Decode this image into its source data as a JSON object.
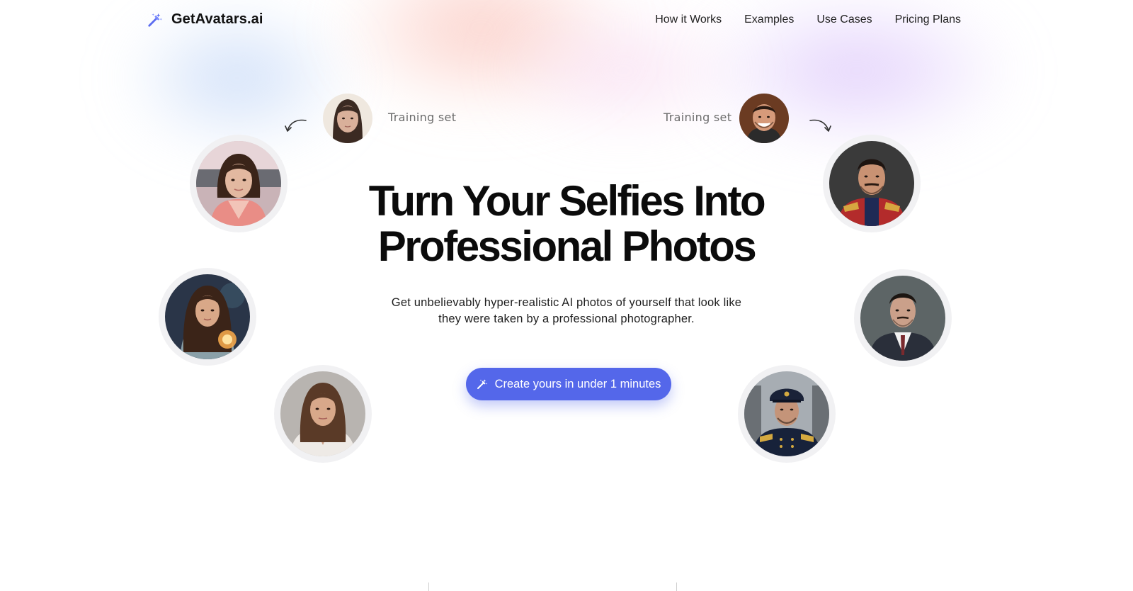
{
  "brand": {
    "name": "GetAvatars.ai",
    "icon": "magic-wand-icon",
    "accent": "#5467ea"
  },
  "nav": {
    "links": [
      {
        "label": "How it Works"
      },
      {
        "label": "Examples"
      },
      {
        "label": "Use Cases"
      },
      {
        "label": "Pricing Plans"
      }
    ]
  },
  "training": {
    "left_label": "Training set",
    "right_label": "Training set"
  },
  "hero": {
    "title_line1": "Turn Your Selfies Into",
    "title_line2": "Professional Photos",
    "subtitle": "Get unbelievably hyper-realistic AI photos of yourself that look like they were taken by a professional photographer.",
    "cta_label": "Create yours in under 1 minutes",
    "cta_icon": "magic-wand-icon"
  },
  "avatars": {
    "left": [
      "kimono-portrait",
      "fantasy-lantern-portrait",
      "business-woman-portrait"
    ],
    "right": [
      "royal-uniform-portrait",
      "suit-portrait",
      "naval-officer-portrait"
    ],
    "training": [
      "training-woman-selfie",
      "training-man-selfie"
    ]
  }
}
